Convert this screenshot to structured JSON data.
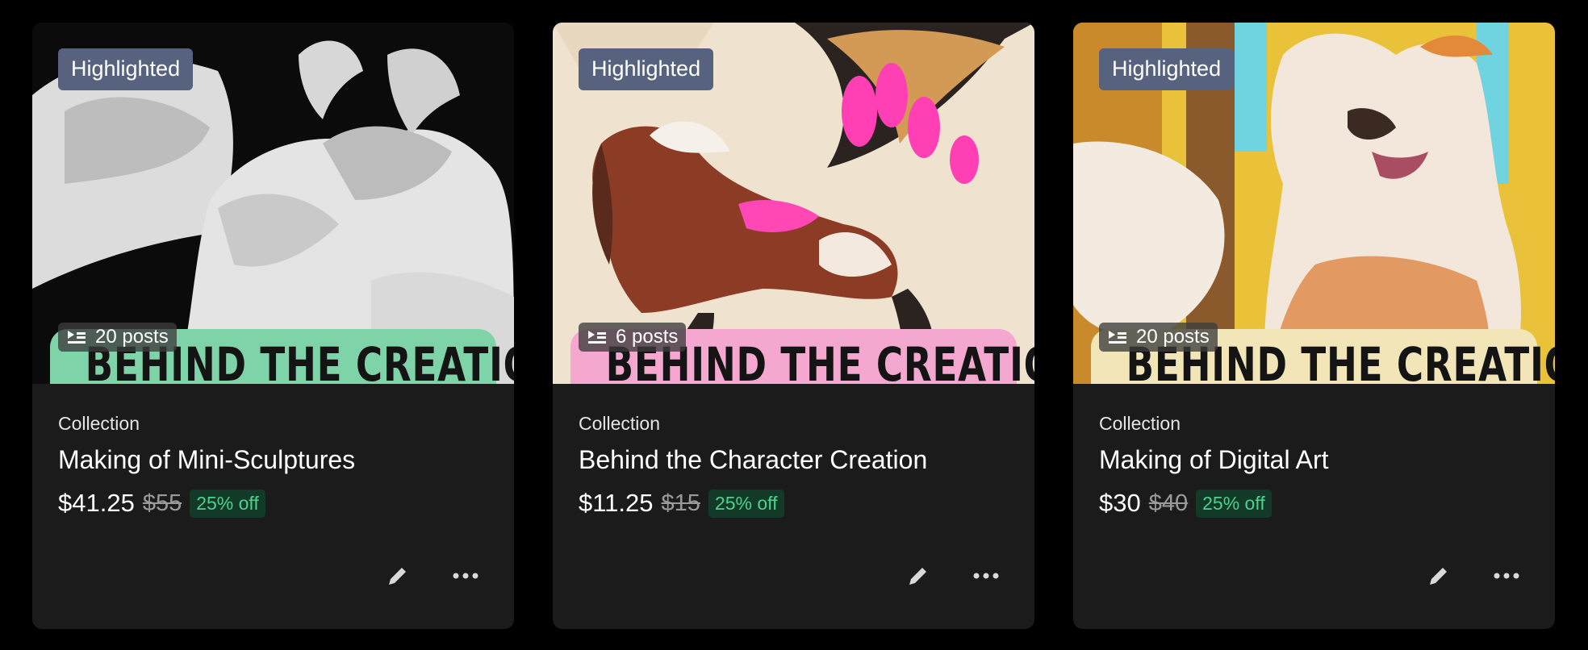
{
  "cards": [
    {
      "badge": "Highlighted",
      "posts": "20 posts",
      "banner_text": "BEHIND THE CREATION",
      "banner_color": "#7fd3a8",
      "type": "Collection",
      "title": "Making of Mini-Sculptures",
      "price": "$41.25",
      "old_price": "$55",
      "discount": "25% off"
    },
    {
      "badge": "Highlighted",
      "posts": "6 posts",
      "banner_text": "BEHIND THE CREATION",
      "banner_color": "#f4a7cf",
      "type": "Collection",
      "title": "Behind the Character Creation",
      "price": "$11.25",
      "old_price": "$15",
      "discount": "25% off"
    },
    {
      "badge": "Highlighted",
      "posts": "20 posts",
      "banner_text": "BEHIND THE CREATION",
      "banner_color": "#f2e6b8",
      "type": "Collection",
      "title": "Making of Digital Art",
      "price": "$30",
      "old_price": "$40",
      "discount": "25% off"
    }
  ],
  "colors": {
    "badge_bg": "#57627f",
    "discount_text": "#4cd28b",
    "discount_bg": "#133a28",
    "card_bg": "#1b1b1b",
    "page_bg": "#000000"
  },
  "icons": [
    "list-icon",
    "pencil-icon",
    "more-icon"
  ]
}
